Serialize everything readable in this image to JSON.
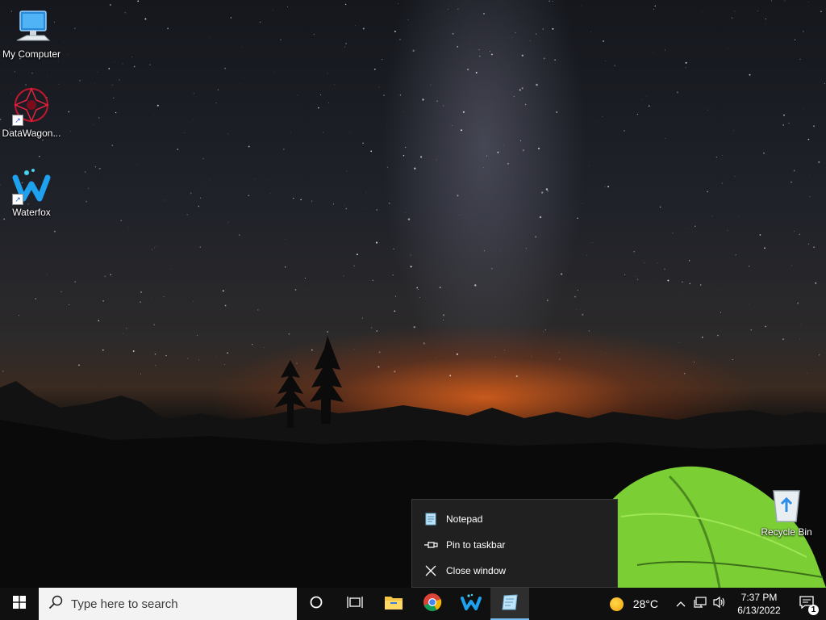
{
  "desktop": {
    "icons": [
      {
        "label": "My Computer"
      },
      {
        "label": "DataWagon..."
      },
      {
        "label": "Waterfox"
      },
      {
        "label": "Recycle Bin"
      }
    ]
  },
  "context_menu": {
    "items": [
      {
        "label": "Notepad",
        "icon": "notepad-icon"
      },
      {
        "label": "Pin to taskbar",
        "icon": "pin-icon"
      },
      {
        "label": "Close window",
        "icon": "close-icon"
      }
    ]
  },
  "taskbar": {
    "search_placeholder": "Type here to search",
    "apps": [
      "file-explorer-icon",
      "chrome-icon",
      "waterfox-icon",
      "notepad-icon"
    ],
    "weather": {
      "temp": "28°C"
    },
    "clock": {
      "time": "7:37 PM",
      "date": "6/13/2022"
    },
    "notification_count": "1",
    "accent_color": "#76b9ed"
  }
}
